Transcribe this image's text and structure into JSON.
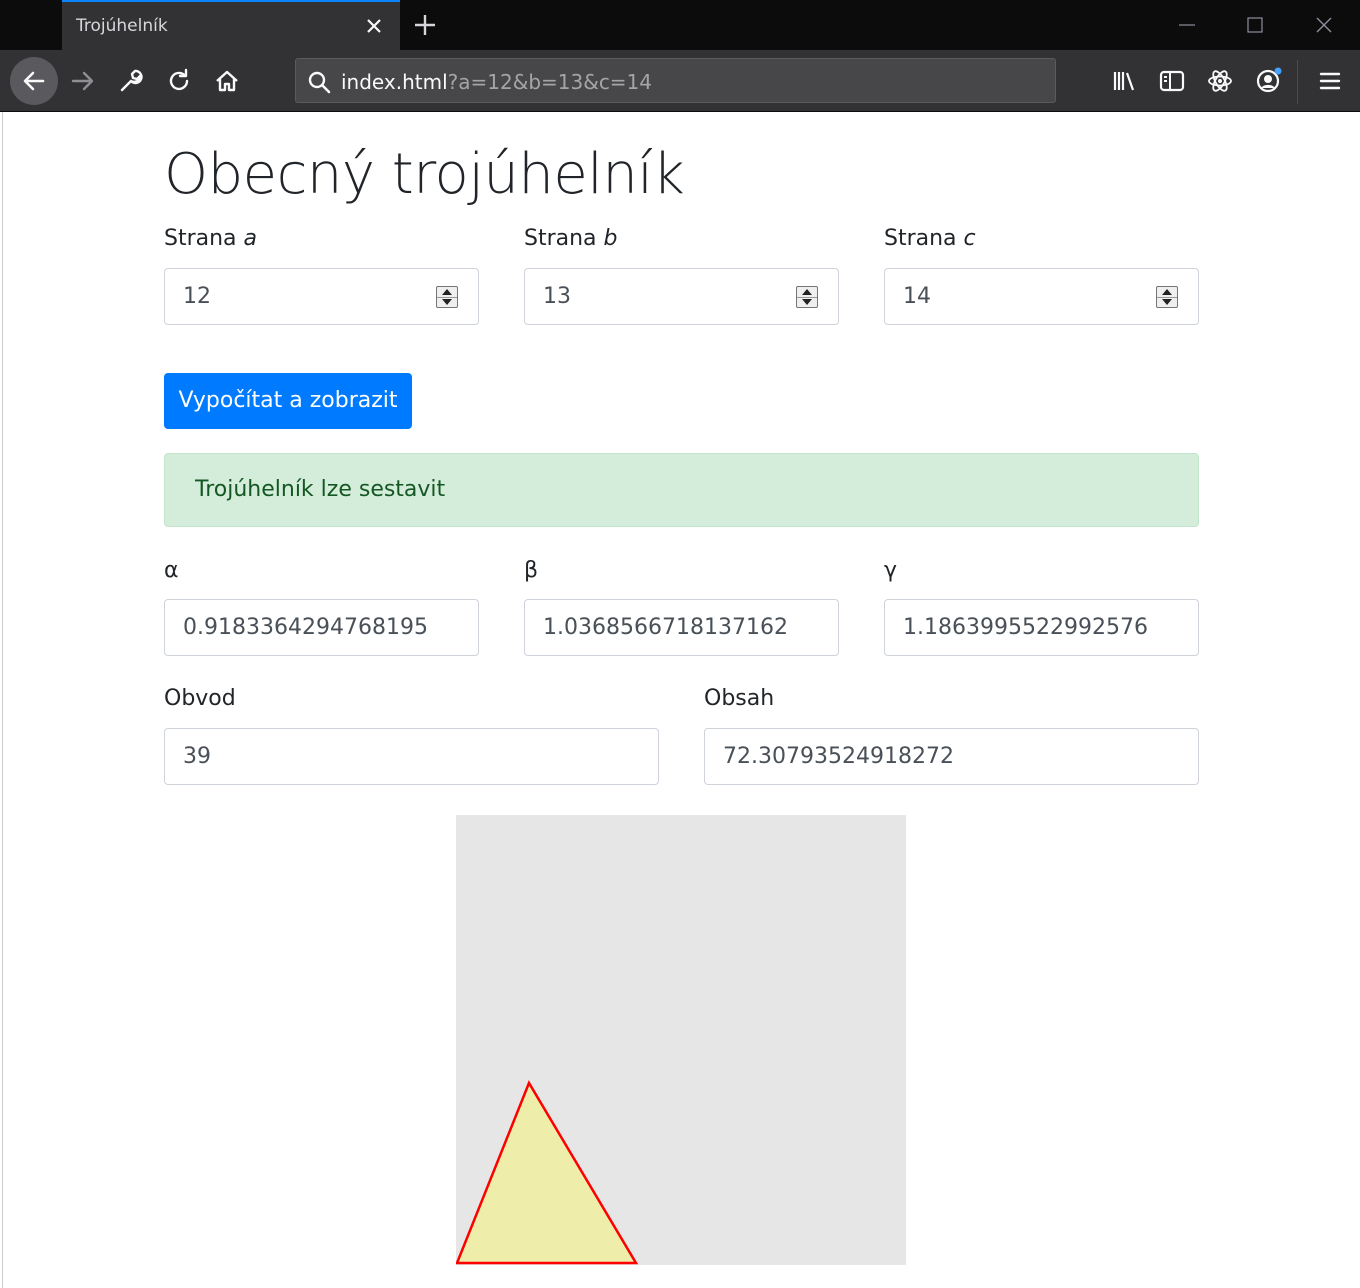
{
  "browser": {
    "tab_title": "Trojúhelník",
    "url_main": "index.html",
    "url_query": "?a=12&b=13&c=14"
  },
  "page": {
    "title": "Obecný trojúhelník",
    "side_label": "Strana",
    "sides": [
      {
        "var": "a",
        "value": "12"
      },
      {
        "var": "b",
        "value": "13"
      },
      {
        "var": "c",
        "value": "14"
      }
    ],
    "submit_label": "Vypočítat a zobrazit",
    "alert_text": "Trojúhelník lze sestavit",
    "angles": [
      {
        "label": "α",
        "value": "0.9183364294768195"
      },
      {
        "label": "β",
        "value": "1.0368566718137162"
      },
      {
        "label": "γ",
        "value": "1.1863995522992576"
      }
    ],
    "perimeter": {
      "label": "Obvod",
      "value": "39"
    },
    "area": {
      "label": "Obsah",
      "value": "72.30793524918272"
    }
  },
  "colors": {
    "primary": "#007bff",
    "alert_bg": "#d4edda",
    "alert_text": "#155724",
    "triangle_fill": "#eeeeaa",
    "triangle_stroke": "#ff0000",
    "canvas_bg": "#e6e6e6"
  },
  "icons": [
    "back-arrow-icon",
    "forward-arrow-icon",
    "wrench-icon",
    "reload-icon",
    "home-icon",
    "search-icon",
    "library-icon",
    "sidebar-icon",
    "react-devtools-icon",
    "account-icon",
    "hamburger-menu-icon",
    "close-icon",
    "plus-icon",
    "minimize-icon",
    "maximize-icon"
  ]
}
